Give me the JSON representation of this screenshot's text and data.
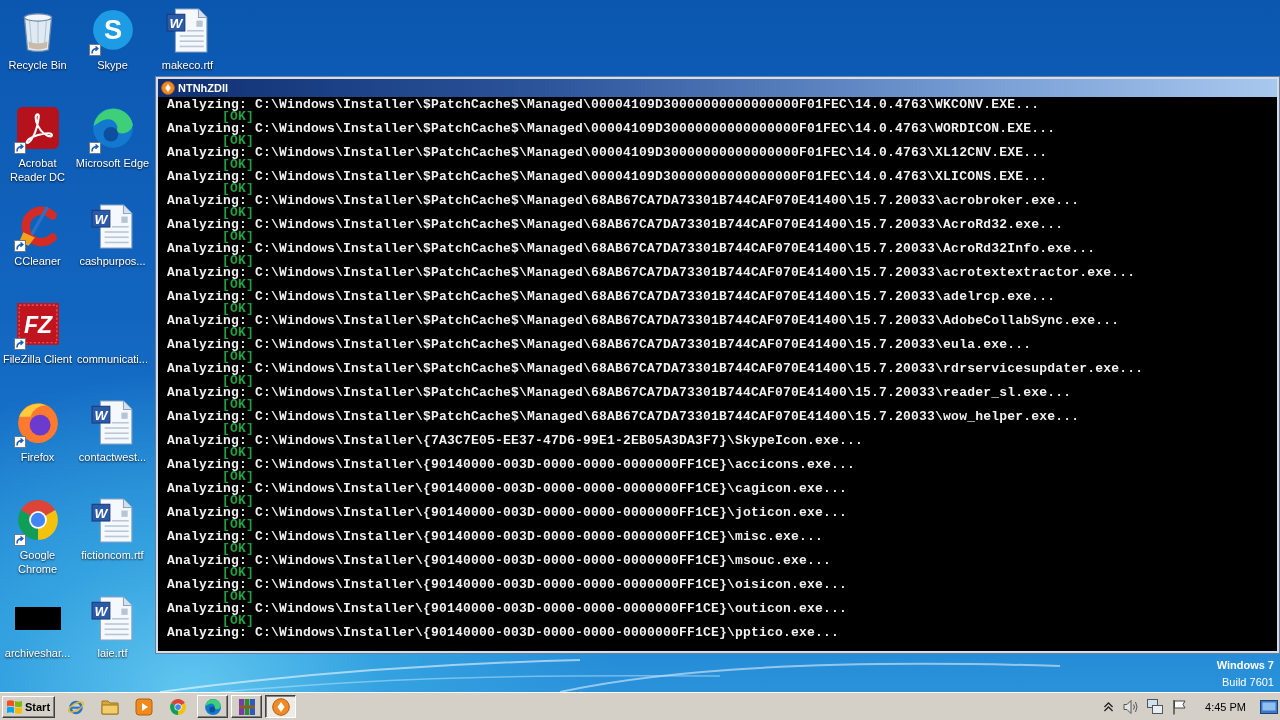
{
  "desktop_icons": [
    {
      "label": "Recycle Bin",
      "kind": "recycle-bin",
      "shortcut": false
    },
    {
      "label": "Acrobat Reader DC",
      "kind": "acrobat",
      "shortcut": true
    },
    {
      "label": "CCleaner",
      "kind": "ccleaner",
      "shortcut": true
    },
    {
      "label": "FileZilla Client",
      "kind": "filezilla",
      "glyph": "FZ",
      "shortcut": true
    },
    {
      "label": "Firefox",
      "kind": "firefox",
      "shortcut": true
    },
    {
      "label": "Google Chrome",
      "kind": "chrome",
      "shortcut": true
    },
    {
      "label": "archiveshar...",
      "kind": "dark-thumbnail",
      "shortcut": false
    },
    {
      "label": "Skype",
      "kind": "skype",
      "glyph": "S",
      "shortcut": true
    },
    {
      "label": "Microsoft Edge",
      "kind": "edge",
      "shortcut": true
    },
    {
      "label": "cashpurpos...",
      "kind": "word-document",
      "glyph": "W",
      "shortcut": false
    },
    {
      "label": "communicati...",
      "kind": "blank",
      "shortcut": false
    },
    {
      "label": "contactwest...",
      "kind": "word-document",
      "glyph": "W",
      "shortcut": false
    },
    {
      "label": "fictioncom.rtf",
      "kind": "word-document",
      "glyph": "W",
      "shortcut": false
    },
    {
      "label": "laie.rtf",
      "kind": "word-document",
      "glyph": "W",
      "shortcut": false
    },
    {
      "label": "makeco.rtf",
      "kind": "word-document",
      "glyph": "W",
      "shortcut": false
    }
  ],
  "console_window": {
    "title": "NTNhZDll",
    "lines": [
      {
        "text": "Analyzing: C:\\Windows\\Installer\\$PatchCache$\\Managed\\00004109D30000000000000000F01FEC\\14.0.4763\\WKCONV.EXE...",
        "status": "[OK]"
      },
      {
        "text": "Analyzing: C:\\Windows\\Installer\\$PatchCache$\\Managed\\00004109D30000000000000000F01FEC\\14.0.4763\\WORDICON.EXE...",
        "status": "[OK]"
      },
      {
        "text": "Analyzing: C:\\Windows\\Installer\\$PatchCache$\\Managed\\00004109D30000000000000000F01FEC\\14.0.4763\\XL12CNV.EXE...",
        "status": "[OK]"
      },
      {
        "text": "Analyzing: C:\\Windows\\Installer\\$PatchCache$\\Managed\\00004109D30000000000000000F01FEC\\14.0.4763\\XLICONS.EXE...",
        "status": "[OK]"
      },
      {
        "text": "Analyzing: C:\\Windows\\Installer\\$PatchCache$\\Managed\\68AB67CA7DA73301B744CAF070E41400\\15.7.20033\\acrobroker.exe...",
        "status": "[OK]"
      },
      {
        "text": "Analyzing: C:\\Windows\\Installer\\$PatchCache$\\Managed\\68AB67CA7DA73301B744CAF070E41400\\15.7.20033\\AcroRd32.exe...",
        "status": "[OK]"
      },
      {
        "text": "Analyzing: C:\\Windows\\Installer\\$PatchCache$\\Managed\\68AB67CA7DA73301B744CAF070E41400\\15.7.20033\\AcroRd32Info.exe...",
        "status": "[OK]"
      },
      {
        "text": "Analyzing: C:\\Windows\\Installer\\$PatchCache$\\Managed\\68AB67CA7DA73301B744CAF070E41400\\15.7.20033\\acrotextextractor.exe...",
        "status": "[OK]"
      },
      {
        "text": "Analyzing: C:\\Windows\\Installer\\$PatchCache$\\Managed\\68AB67CA7DA73301B744CAF070E41400\\15.7.20033\\adelrcp.exe...",
        "status": "[OK]"
      },
      {
        "text": "Analyzing: C:\\Windows\\Installer\\$PatchCache$\\Managed\\68AB67CA7DA73301B744CAF070E41400\\15.7.20033\\AdobeCollabSync.exe...",
        "status": "[OK]"
      },
      {
        "text": "Analyzing: C:\\Windows\\Installer\\$PatchCache$\\Managed\\68AB67CA7DA73301B744CAF070E41400\\15.7.20033\\eula.exe...",
        "status": "[OK]"
      },
      {
        "text": "Analyzing: C:\\Windows\\Installer\\$PatchCache$\\Managed\\68AB67CA7DA73301B744CAF070E41400\\15.7.20033\\rdrservicesupdater.exe...",
        "status": "[OK]"
      },
      {
        "text": "Analyzing: C:\\Windows\\Installer\\$PatchCache$\\Managed\\68AB67CA7DA73301B744CAF070E41400\\15.7.20033\\reader_sl.exe...",
        "status": "[OK]"
      },
      {
        "text": "Analyzing: C:\\Windows\\Installer\\$PatchCache$\\Managed\\68AB67CA7DA73301B744CAF070E41400\\15.7.20033\\wow_helper.exe...",
        "status": "[OK]"
      },
      {
        "text": "Analyzing: C:\\Windows\\Installer\\{7A3C7E05-EE37-47D6-99E1-2EB05A3DA3F7}\\SkypeIcon.exe...",
        "status": "[OK]"
      },
      {
        "text": "Analyzing: C:\\Windows\\Installer\\{90140000-003D-0000-0000-0000000FF1CE}\\accicons.exe...",
        "status": "[OK]"
      },
      {
        "text": "Analyzing: C:\\Windows\\Installer\\{90140000-003D-0000-0000-0000000FF1CE}\\cagicon.exe...",
        "status": "[OK]"
      },
      {
        "text": "Analyzing: C:\\Windows\\Installer\\{90140000-003D-0000-0000-0000000FF1CE}\\joticon.exe...",
        "status": "[OK]"
      },
      {
        "text": "Analyzing: C:\\Windows\\Installer\\{90140000-003D-0000-0000-0000000FF1CE}\\misc.exe...",
        "status": "[OK]"
      },
      {
        "text": "Analyzing: C:\\Windows\\Installer\\{90140000-003D-0000-0000-0000000FF1CE}\\msouc.exe...",
        "status": "[OK]"
      },
      {
        "text": "Analyzing: C:\\Windows\\Installer\\{90140000-003D-0000-0000-0000000FF1CE}\\oisicon.exe...",
        "status": "[OK]"
      },
      {
        "text": "Analyzing: C:\\Windows\\Installer\\{90140000-003D-0000-0000-0000000FF1CE}\\outicon.exe...",
        "status": "[OK]"
      },
      {
        "text": "Analyzing: C:\\Windows\\Installer\\{90140000-003D-0000-0000-0000000FF1CE}\\pptico.exe..."
      }
    ]
  },
  "os_info": {
    "edition": "Windows 7",
    "build": "Build 7601"
  },
  "taskbar": {
    "start_label": "Start",
    "quick_launch": [
      {
        "kind": "internet-explorer"
      },
      {
        "kind": "folder"
      },
      {
        "kind": "media-player"
      },
      {
        "kind": "chrome"
      }
    ],
    "tasks": [
      {
        "kind": "edge",
        "selected": false
      },
      {
        "kind": "books",
        "selected": false
      },
      {
        "kind": "program",
        "selected": true
      }
    ],
    "tray": {
      "icons": [
        {
          "kind": "chevron-up"
        },
        {
          "kind": "speaker"
        },
        {
          "kind": "network"
        },
        {
          "kind": "flag"
        }
      ],
      "time": "4:45 PM"
    }
  }
}
